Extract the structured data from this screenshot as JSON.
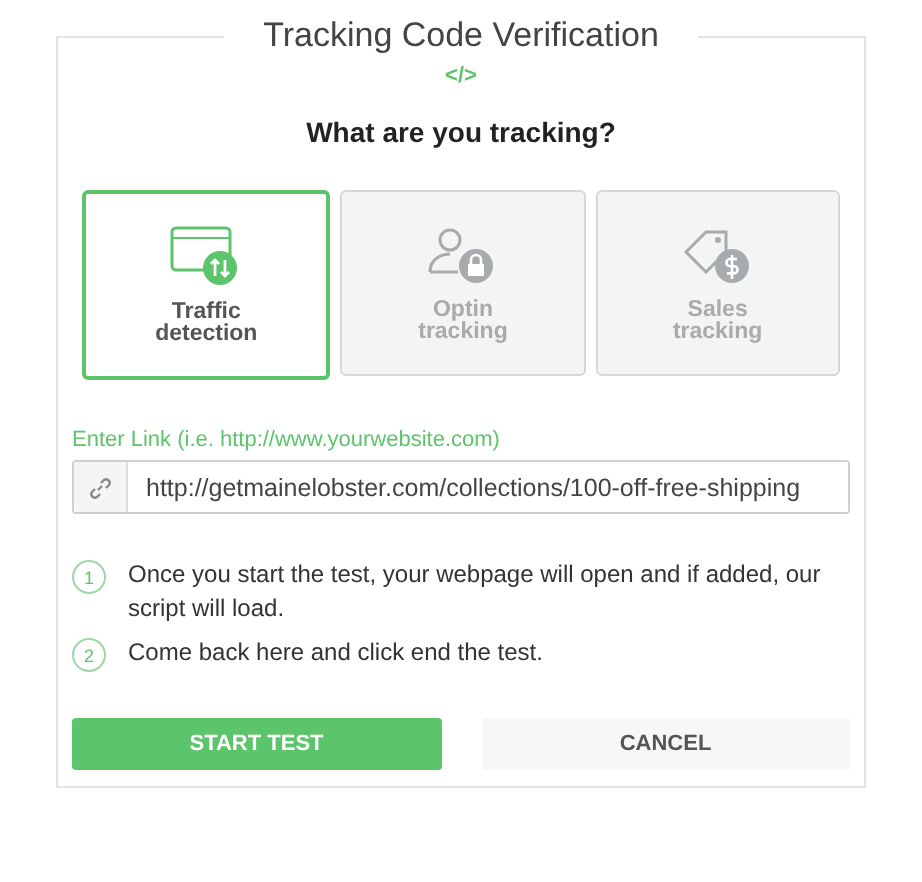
{
  "title": "Tracking Code Verification",
  "code_symbol": "</>",
  "heading": "What are you tracking?",
  "options": [
    {
      "kind": "traffic",
      "label": "Traffic detection",
      "selected": true
    },
    {
      "kind": "optin",
      "label": "Optin tracking",
      "selected": false
    },
    {
      "kind": "sales",
      "label": "Sales tracking",
      "selected": false
    }
  ],
  "link": {
    "label": "Enter Link (i.e. http://www.yourwebsite.com)",
    "value": "http://getmainelobster.com/collections/100-off-free-shipping"
  },
  "steps": [
    {
      "number": "1",
      "text": "Once you start the test, your webpage will open and if added, our script will load."
    },
    {
      "number": "2",
      "text": "Come back here and click end the test."
    }
  ],
  "buttons": [
    {
      "kind": "primary",
      "label": "START TEST"
    },
    {
      "kind": "secondary",
      "label": "CANCEL"
    }
  ]
}
